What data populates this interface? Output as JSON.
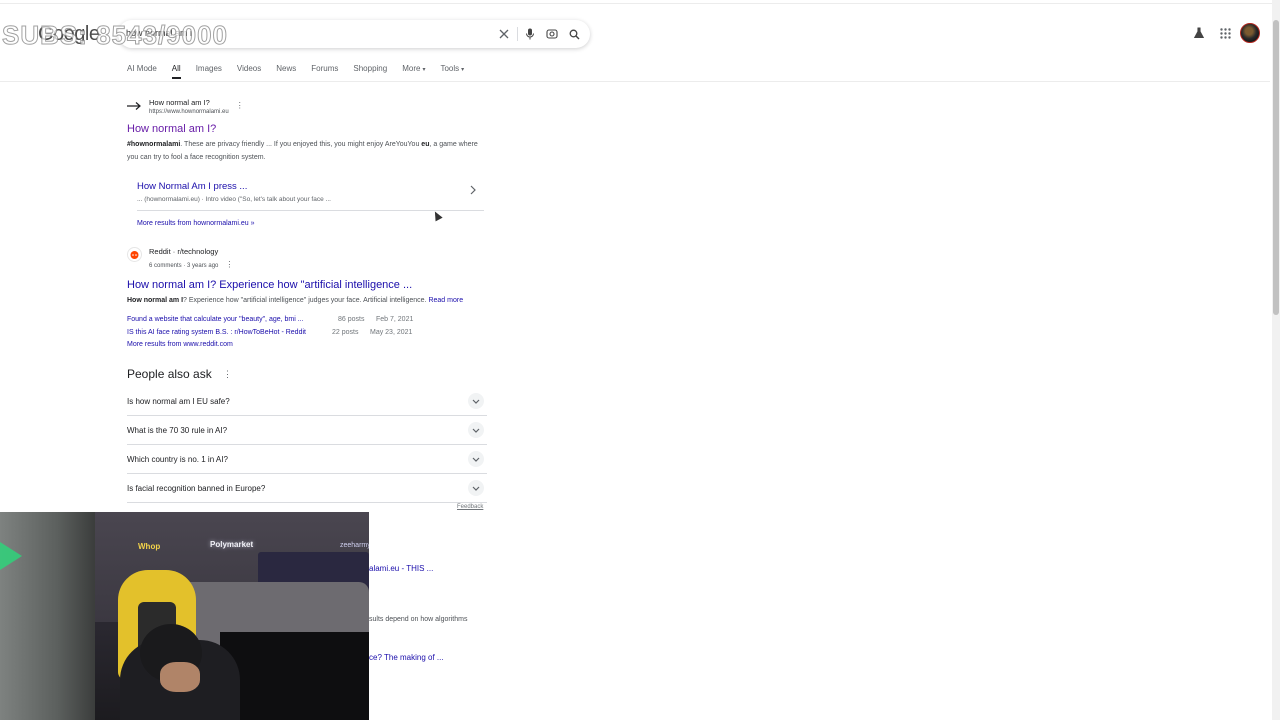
{
  "overlay": {
    "subs_counter": "SUBS: 8543/9000"
  },
  "header": {
    "logo": "Google",
    "search_value": "how normal am i",
    "icons": [
      "clear-icon",
      "mic-icon",
      "lens-icon",
      "search-icon",
      "labs-flask-icon",
      "apps-grid-icon"
    ]
  },
  "tabs": [
    {
      "label": "AI Mode"
    },
    {
      "label": "All",
      "active": true
    },
    {
      "label": "Images"
    },
    {
      "label": "Videos"
    },
    {
      "label": "News"
    },
    {
      "label": "Forums"
    },
    {
      "label": "Shopping"
    },
    {
      "label": "More",
      "caret": "▾"
    },
    {
      "label": "Tools",
      "caret": "▾"
    }
  ],
  "result1": {
    "site_name": "How normal am I?",
    "url": "https://www.hownormalami.eu",
    "title": "How normal am I?",
    "snippet_bold": "#hownormalami",
    "snippet_a": ". These are privacy friendly ... If you enjoyed this, you might enjoy AreYouYou ",
    "snippet_bold2": "eu",
    "snippet_b": ", a game where you can try to fool a face recognition system.",
    "sub_title": "How Normal Am I press ...",
    "sub_desc": "... (hownormalami.eu) · Intro video (\"So, let's talk about your face ...",
    "more_results": "More results from hownormalami.eu »"
  },
  "result2": {
    "site_name": "Reddit · r/technology",
    "meta": "6 comments · 3 years ago",
    "title": "How normal am I? Experience how \"artificial intelligence ...",
    "snippet_bold": "How normal am I",
    "snippet": "? Experience how \"artificial intelligence\" judges your face. Artificial intelligence. ",
    "read_more": "Read more",
    "links": [
      {
        "text": "Found a website that calculate your \"beauty\", age, bmi ...",
        "posts": "86 posts",
        "date": "Feb 7, 2021"
      },
      {
        "text": "IS this AI face rating system B.S. : r/HowToBeHot - Reddit",
        "posts": "22 posts",
        "date": "May 23, 2021"
      }
    ],
    "more_results": "More results from www.reddit.com"
  },
  "paa": {
    "heading": "People also ask",
    "questions": [
      "Is how normal am I EU safe?",
      "What is the 70 30 rule in AI?",
      "Which country is no. 1 in AI?",
      "Is facial recognition banned in Europe?"
    ],
    "feedback": "Feedback"
  },
  "partial": {
    "line1": "alami.eu - THIS ...",
    "line2": "sults depend on how algorithms",
    "line3": "ce? The making of ..."
  },
  "webcam": {
    "neon_1": "Whop",
    "neon_2": "Polymarket",
    "neon_3": "zeeharmy"
  }
}
